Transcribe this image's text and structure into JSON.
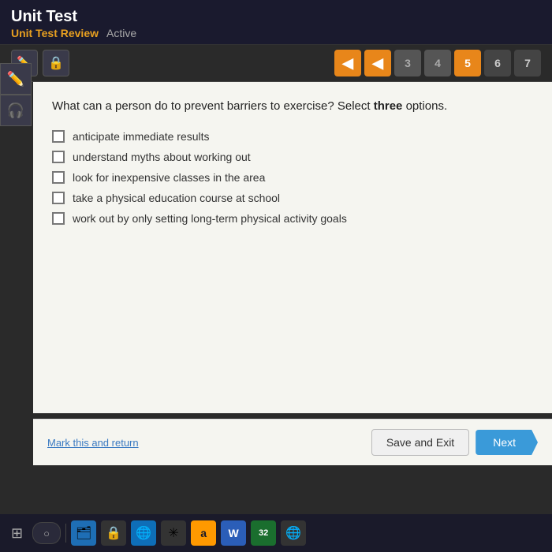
{
  "header": {
    "title": "Unit Test",
    "subtitle": "Unit Test Review",
    "status": "Active"
  },
  "toolbar": {
    "nav_buttons": [
      {
        "label": "◀",
        "type": "arrow",
        "id": "back1"
      },
      {
        "label": "◀",
        "type": "arrow",
        "id": "back2"
      },
      {
        "label": "3",
        "type": "num",
        "state": "inactive",
        "id": "pg3"
      },
      {
        "label": "4",
        "type": "num",
        "state": "inactive",
        "id": "pg4"
      },
      {
        "label": "5",
        "type": "num",
        "state": "active",
        "id": "pg5"
      },
      {
        "label": "6",
        "type": "num",
        "state": "num",
        "id": "pg6"
      },
      {
        "label": "7",
        "type": "num",
        "state": "num",
        "id": "pg7"
      }
    ]
  },
  "question": {
    "text": "What can a person do to prevent barriers to exercise? Select ",
    "bold_word": "three",
    "text_after": " options.",
    "options": [
      {
        "id": "opt1",
        "label": "anticipate immediate results",
        "checked": false
      },
      {
        "id": "opt2",
        "label": "understand myths about working out",
        "checked": false
      },
      {
        "id": "opt3",
        "label": "look for inexpensive classes in the area",
        "checked": false
      },
      {
        "id": "opt4",
        "label": "take a physical education course at school",
        "checked": false
      },
      {
        "id": "opt5",
        "label": "work out by only setting long-term physical activity goals",
        "checked": false
      }
    ]
  },
  "actions": {
    "mark_return": "Mark this and return",
    "save_exit": "Save and Exit",
    "next": "Next"
  },
  "taskbar": {
    "apps": [
      "⊞",
      "🔍",
      "📁",
      "🔒",
      "🌐",
      "✳",
      "a",
      "W",
      "32",
      "🌐"
    ]
  }
}
